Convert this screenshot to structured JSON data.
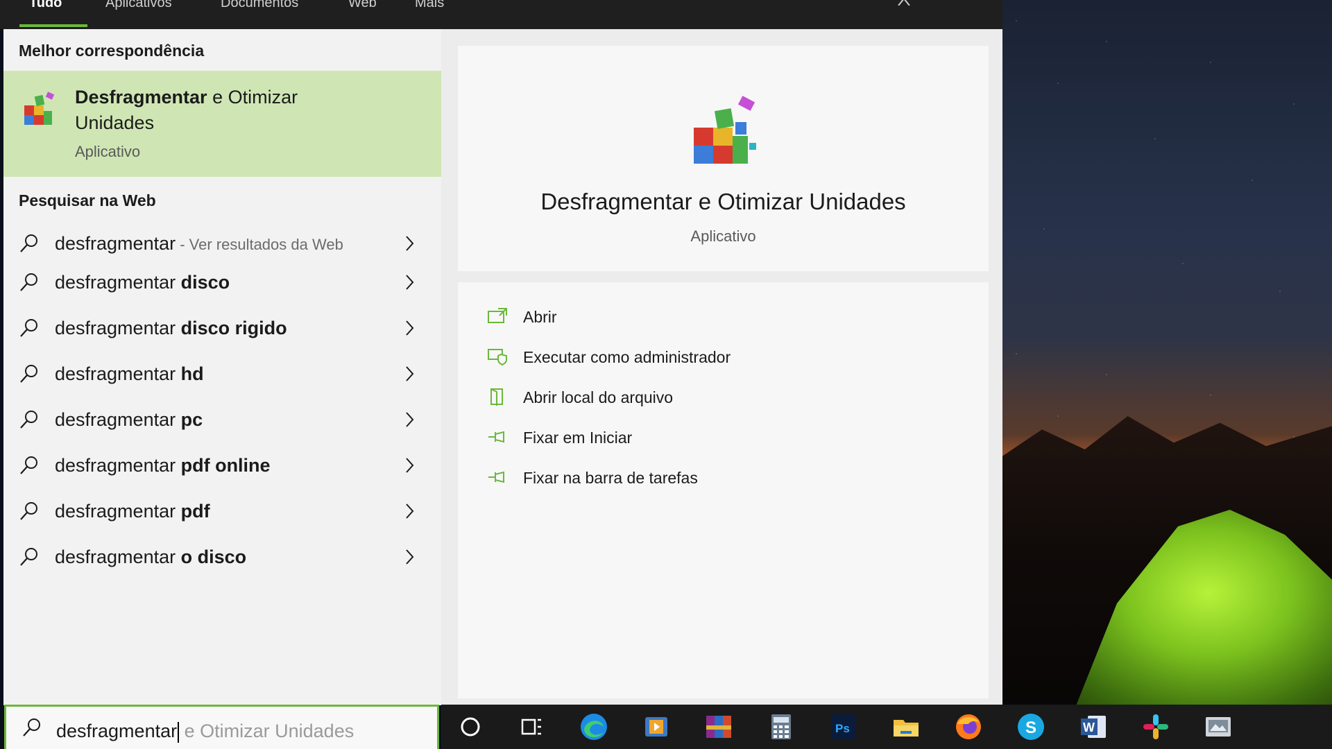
{
  "top_tabs": {
    "items": [
      "Tudo",
      "Aplicativos",
      "Documentos",
      "Web",
      "Mais"
    ],
    "active_index": 0
  },
  "left_panel": {
    "best_match_header": "Melhor correspondência",
    "best_match": {
      "title_bold": "Desfragmentar",
      "title_rest": " e Otimizar",
      "title_line2": "Unidades",
      "subtitle": "Aplicativo",
      "icon": "defrag-app-icon"
    },
    "web_header": "Pesquisar na Web",
    "web_results": [
      {
        "prefix": "desfragmentar",
        "bold": "",
        "hint": " - Ver resultados da Web"
      },
      {
        "prefix": "desfragmentar ",
        "bold": "disco",
        "hint": ""
      },
      {
        "prefix": "desfragmentar ",
        "bold": "disco rigido",
        "hint": ""
      },
      {
        "prefix": "desfragmentar ",
        "bold": "hd",
        "hint": ""
      },
      {
        "prefix": "desfragmentar ",
        "bold": "pc",
        "hint": ""
      },
      {
        "prefix": "desfragmentar ",
        "bold": "pdf online",
        "hint": ""
      },
      {
        "prefix": "desfragmentar ",
        "bold": "pdf",
        "hint": ""
      },
      {
        "prefix": "desfragmentar ",
        "bold": "o disco",
        "hint": ""
      }
    ]
  },
  "preview": {
    "title": "Desfragmentar e Otimizar Unidades",
    "subtitle": "Aplicativo",
    "actions": [
      {
        "label": "Abrir",
        "icon": "open-icon"
      },
      {
        "label": "Executar como administrador",
        "icon": "run-as-admin-icon"
      },
      {
        "label": "Abrir local do arquivo",
        "icon": "open-file-location-icon"
      },
      {
        "label": "Fixar em Iniciar",
        "icon": "pin-to-start-icon"
      },
      {
        "label": "Fixar na barra de tarefas",
        "icon": "pin-to-taskbar-icon"
      }
    ]
  },
  "search": {
    "typed": "desfragmentar",
    "suggestion": "e Otimizar Unidades"
  },
  "taskbar": {
    "apps": [
      "cortana-icon",
      "task-view-icon",
      "edge-icon",
      "media-player-icon",
      "winrar-icon",
      "calculator-icon",
      "photoshop-icon",
      "file-explorer-icon",
      "firefox-icon",
      "skype-icon",
      "word-icon",
      "slack-icon",
      "misc-app-icon"
    ]
  },
  "colors": {
    "accent": "#6bb83a",
    "best_match_bg": "#cfe6b4",
    "panel_bg": "#f2f2f2",
    "taskbar_bg": "#1a1a1a"
  }
}
